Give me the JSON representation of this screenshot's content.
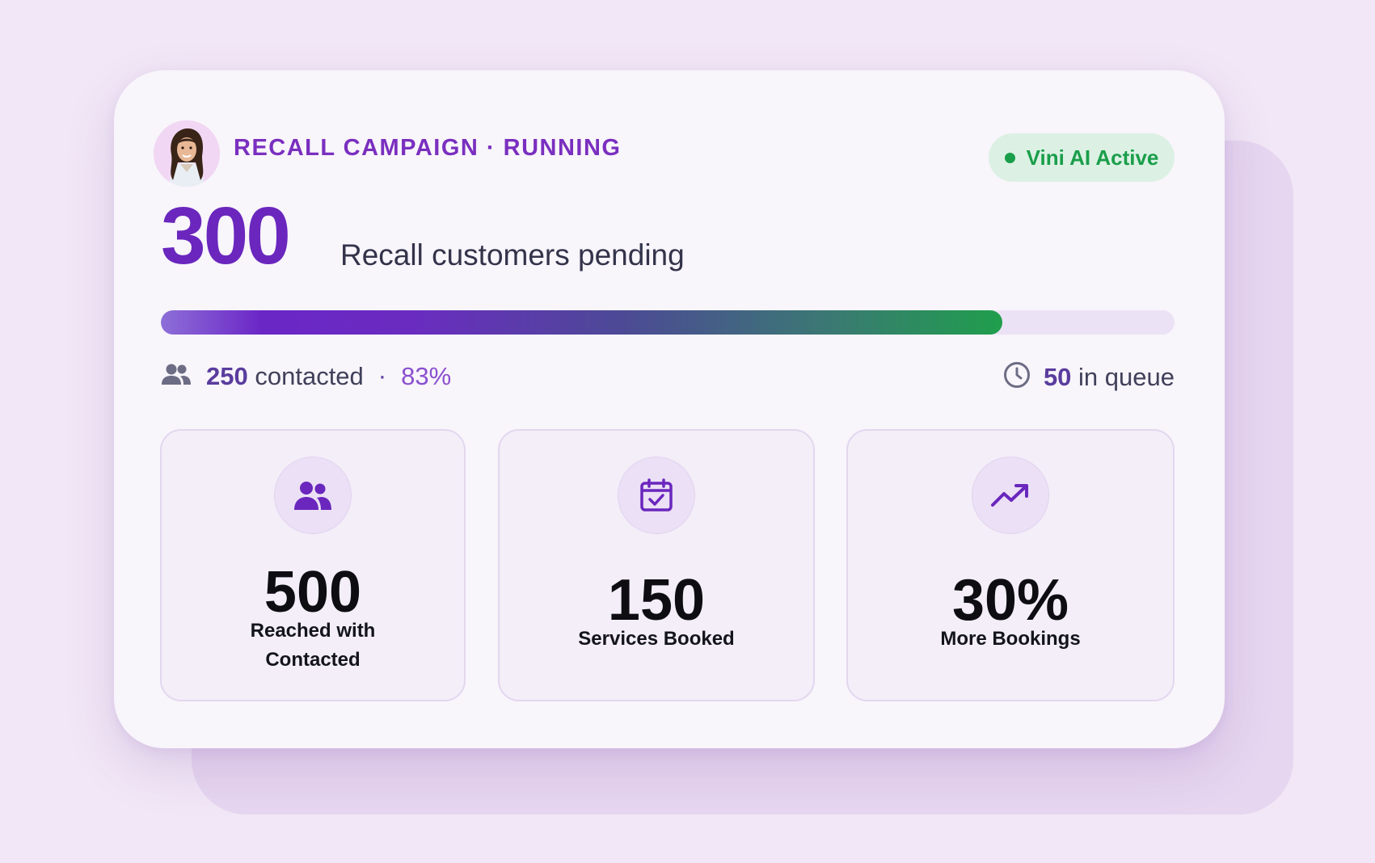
{
  "campaign": {
    "title": "RECALL CAMPAIGN · RUNNING",
    "status_badge": "Vini AI Active",
    "pending_count": "300",
    "pending_label": "Recall customers pending"
  },
  "progress": {
    "fraction": 0.83,
    "contacted_count": "250",
    "contacted_label": "contacted",
    "separator": "·",
    "contacted_percent": "83%",
    "queue_count": "50",
    "queue_label": "in queue"
  },
  "metrics": [
    {
      "icon": "users-icon",
      "value": "500",
      "label": "Reached with Contacted"
    },
    {
      "icon": "calendar-check-icon",
      "value": "150",
      "label": "Services Booked"
    },
    {
      "icon": "trending-up-icon",
      "value": "30%",
      "label": "More Bookings"
    }
  ],
  "colors": {
    "accent": "#6a26bd",
    "success": "#1a9e4a",
    "background": "#f1e7f6",
    "card": "#f8f5fb"
  }
}
